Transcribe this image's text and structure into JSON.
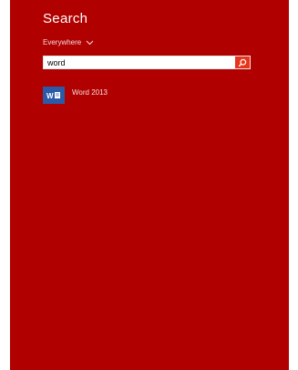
{
  "search_pane": {
    "title": "Search",
    "scope_label": "Everywhere",
    "scope_icon": "chevron-down-icon",
    "query": "word",
    "search_button_icon": "search-icon",
    "results": [
      {
        "label": "Word 2013",
        "icon": "word-app-icon"
      }
    ]
  },
  "colors": {
    "panel_background": "#b10000",
    "search_button": "#e8341a",
    "word_tile": "#2b5aa8"
  }
}
